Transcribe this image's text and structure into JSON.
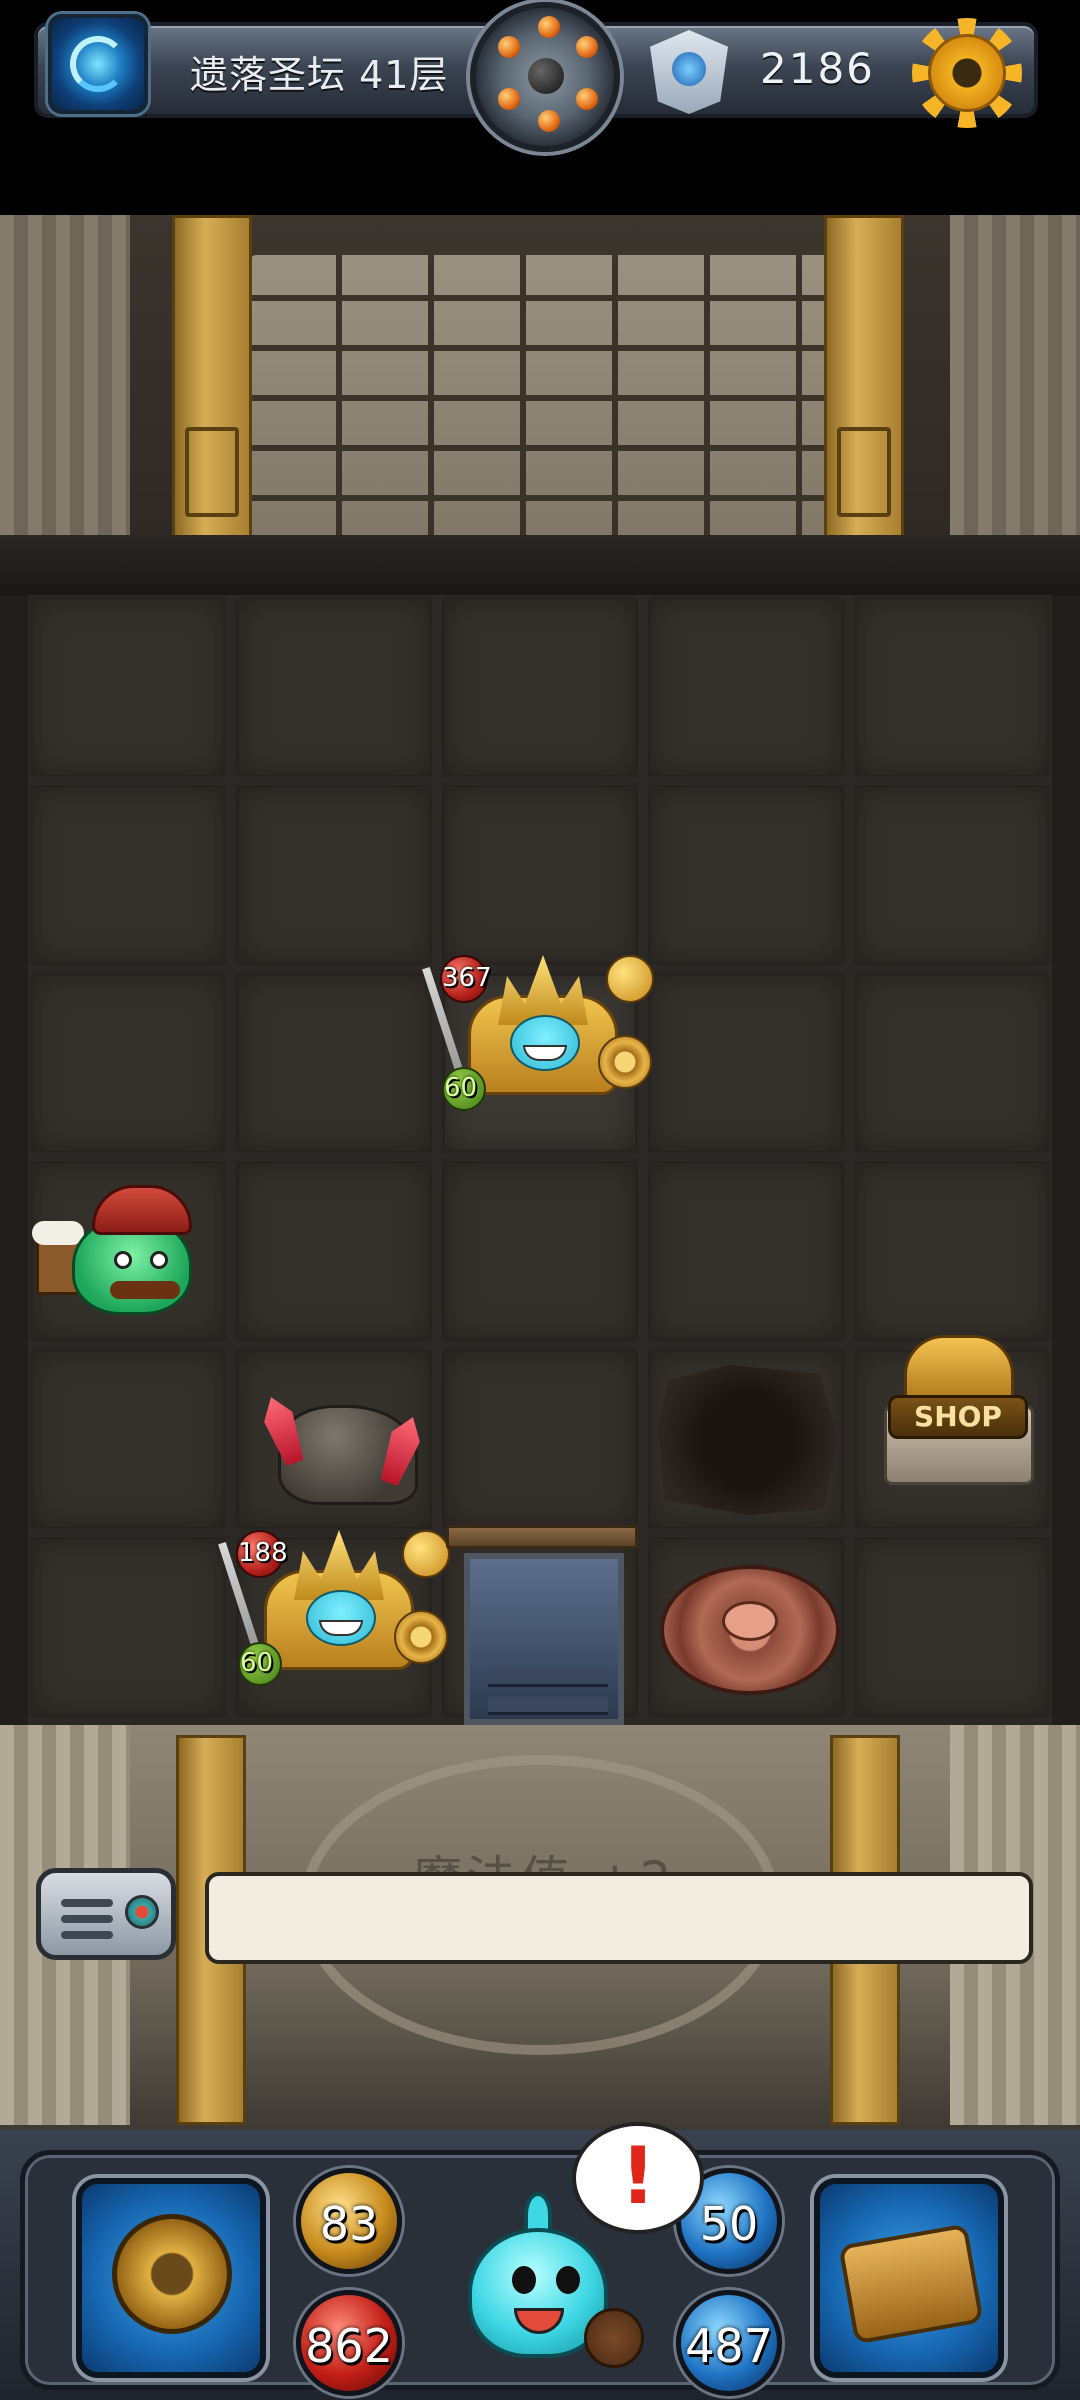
{
  "top_bar": {
    "floor_title": "遗落圣坛 41层",
    "gold_amount": "2186",
    "portal_icon": "portal-icon",
    "bomb_icon": "bomb-wheel-icon",
    "gem_icon": "gem-icon",
    "settings_icon": "gear-icon"
  },
  "board": {
    "enemies": [
      {
        "name": "golden-knight",
        "hp": "367",
        "defense": "60"
      },
      {
        "name": "golden-knight",
        "hp": "188",
        "defense": "60"
      }
    ],
    "objects": [
      "merchant-npc",
      "red-crystal-ore",
      "floor-pit",
      "shop",
      "stairs-down",
      "summoning-altar"
    ],
    "shop_sign": "SHOP"
  },
  "message": {
    "text": "",
    "faded_notice": "魔法值 +2"
  },
  "hud": {
    "attack": "83",
    "hp": "862",
    "defense": "50",
    "mana": "487",
    "alert": "!"
  },
  "colors": {
    "gold": "#f6b526",
    "hp_red": "#c21e16",
    "mana_blue": "#1f74c4",
    "hero_cyan": "#3ed7e4"
  }
}
